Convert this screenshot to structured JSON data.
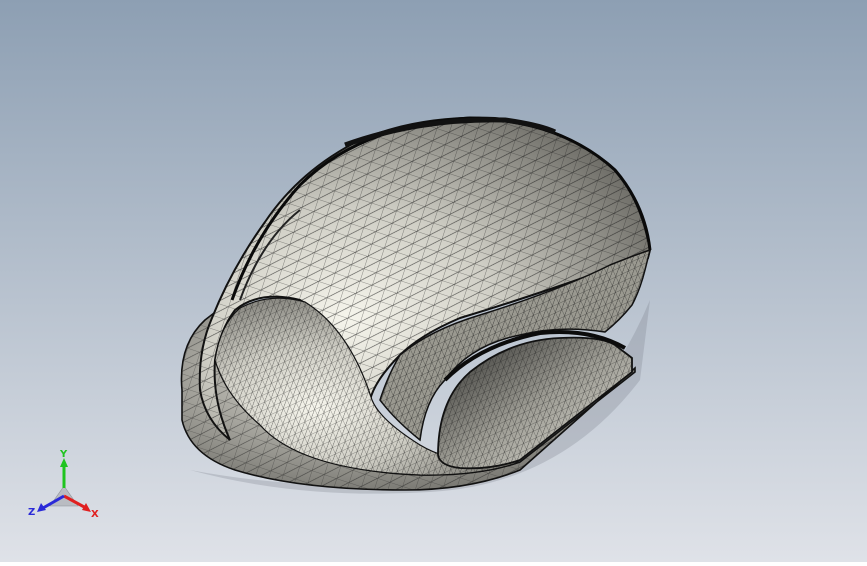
{
  "viewport": {
    "background_top": "#8d9fb3",
    "background_bottom": "#dfe2e8",
    "model_fill": "#c9c8bf",
    "model_highlight": "#f4f3ea",
    "mesh_color": "#1c1c1c"
  },
  "triad": {
    "x_label": "X",
    "y_label": "Y",
    "z_label": "Z",
    "x_color": "#e02020",
    "y_color": "#1fc41f",
    "z_color": "#2a2ad8"
  }
}
